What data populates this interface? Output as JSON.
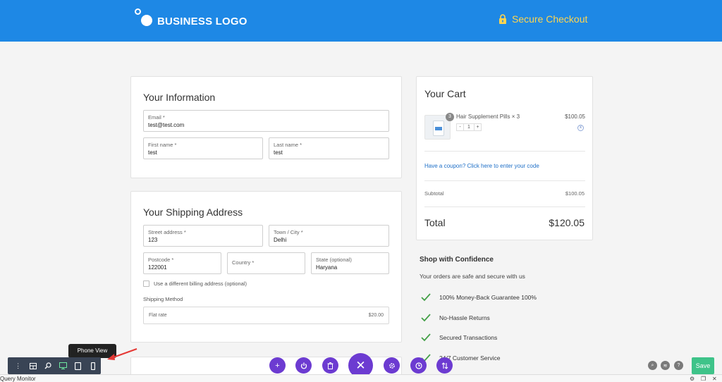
{
  "header": {
    "logo_text": "BUSINESS LOGO",
    "secure_label": "Secure Checkout",
    "bg_color": "#1e88e5",
    "secure_color": "#ffd54f"
  },
  "info": {
    "title": "Your Information",
    "email": {
      "label": "Email *",
      "value": "test@test.com"
    },
    "first_name": {
      "label": "First name *",
      "value": "test"
    },
    "last_name": {
      "label": "Last name *",
      "value": "test"
    }
  },
  "shipping": {
    "title": "Your Shipping Address",
    "street": {
      "label": "Street address *",
      "value": "123"
    },
    "city": {
      "label": "Town / City *",
      "value": "Delhi"
    },
    "postcode": {
      "label": "Postcode *",
      "value": "122001"
    },
    "country": {
      "label": "Country *",
      "value": ""
    },
    "state": {
      "label": "State (optional)",
      "value": "Haryana"
    },
    "diff_billing": "Use a different billing address (optional)",
    "method_label": "Shipping Method",
    "method_name": "Flat rate",
    "method_price": "$20.00"
  },
  "cart": {
    "title": "Your Cart",
    "item": {
      "name": "Hair Supplement Pills × 3",
      "price": "$100.05",
      "qty": "1",
      "badge": "3",
      "minus": "-",
      "plus": "+",
      "remove": "x"
    },
    "coupon": "Have a coupon? Click here to enter your code",
    "subtotal_label": "Subtotal",
    "subtotal_value": "$100.05",
    "total_label": "Total",
    "total_value": "$120.05"
  },
  "confidence": {
    "title": "Shop with Confidence",
    "subtitle": "Your orders are safe and secure with us",
    "items": [
      "100% Money-Back Guarantee 100%",
      "No-Hassle Returns",
      "Secured Transactions",
      "24/7 Customer Service"
    ],
    "check_color": "#43a047"
  },
  "builder": {
    "tooltip": "Phone View",
    "save_label": "Save",
    "accent": "#6c3bd1",
    "save_color": "#3ec389",
    "status_label": "Query Monitor"
  }
}
